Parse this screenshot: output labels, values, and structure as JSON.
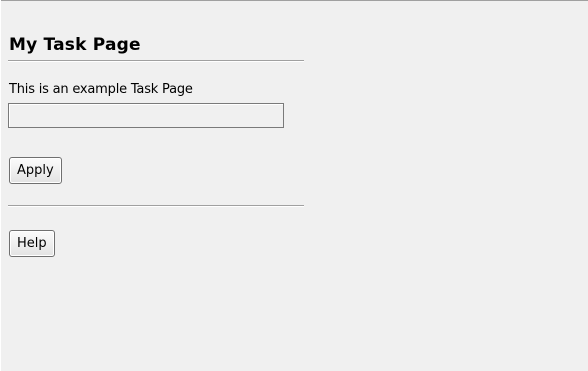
{
  "task_page": {
    "title": "My Task Page",
    "description": "This is an example Task Page",
    "text_field": {
      "value": "",
      "placeholder": ""
    },
    "apply_label": "Apply",
    "help_label": "Help"
  }
}
